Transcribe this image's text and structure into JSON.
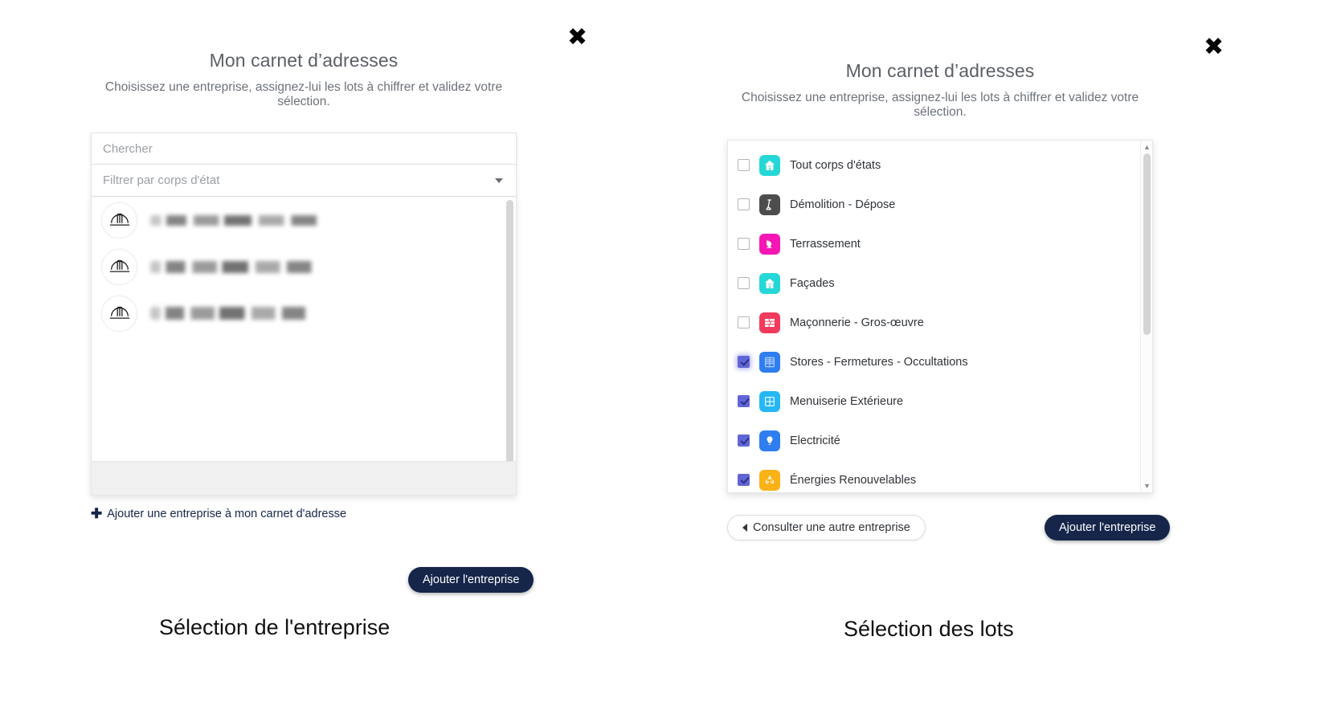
{
  "left": {
    "close_label": "✖",
    "title": "Mon carnet d’adresses",
    "subtitle": "Choisissez une entreprise, assignez-lui les lots à chiffrer et validez votre sélection.",
    "search_placeholder": "Chercher",
    "search_value": "",
    "filter_placeholder": "Filtrer par corps d'état",
    "filter_value": "",
    "companies": [
      {
        "name": "",
        "icon": "hard-hat-icon",
        "redacted": true
      },
      {
        "name": "",
        "icon": "hard-hat-icon",
        "redacted": true
      },
      {
        "name": "",
        "icon": "hard-hat-icon",
        "redacted": true
      }
    ],
    "add_company_link": "Ajouter une entreprise à mon carnet d'adresse",
    "add_company_link_icon": "plus-icon",
    "submit_label": "Ajouter l'entreprise",
    "caption": "Sélection de l'entreprise"
  },
  "right": {
    "close_label": "✖",
    "title": "Mon carnet d’adresses",
    "subtitle": "Choisissez une entreprise, assignez-lui les lots à chiffrer et validez votre sélection.",
    "lots": [
      {
        "label": "Tout corps d'états",
        "checked": false,
        "icon": "house-icon",
        "color": "#25d7d7"
      },
      {
        "label": "Démolition - Dépose",
        "checked": false,
        "icon": "sledgehammer-icon",
        "color": "#4d4d4d"
      },
      {
        "label": "Terrassement",
        "checked": false,
        "icon": "excavator-icon",
        "color": "#f516b4"
      },
      {
        "label": "Façades",
        "checked": false,
        "icon": "house-icon",
        "color": "#25d7d7"
      },
      {
        "label": "Maçonnerie - Gros-œuvre",
        "checked": false,
        "icon": "brick-wall-icon",
        "color": "#f23b5c"
      },
      {
        "label": "Stores - Fermetures - Occultations",
        "checked": true,
        "icon": "blinds-icon",
        "color": "#2f7ef0"
      },
      {
        "label": "Menuiserie Extérieure",
        "checked": true,
        "icon": "window-icon",
        "color": "#26b7f5"
      },
      {
        "label": "Electricité",
        "checked": true,
        "icon": "bulb-icon",
        "color": "#2f7ef0"
      },
      {
        "label": "Énergies Renouvelables",
        "checked": true,
        "icon": "recycle-icon",
        "color": "#fbb217"
      }
    ],
    "back_label": "Consulter une autre entreprise",
    "back_icon": "triangle-left-icon",
    "submit_label": "Ajouter l'entreprise",
    "caption": "Sélection des lots",
    "scroll_up_icon": "chevron-up-icon",
    "scroll_down_icon": "chevron-down-icon"
  },
  "colors": {
    "primary": "#16264a",
    "checkbox_checked": "#6166d6",
    "text": "#2f3338",
    "muted": "#9aa0a6"
  }
}
